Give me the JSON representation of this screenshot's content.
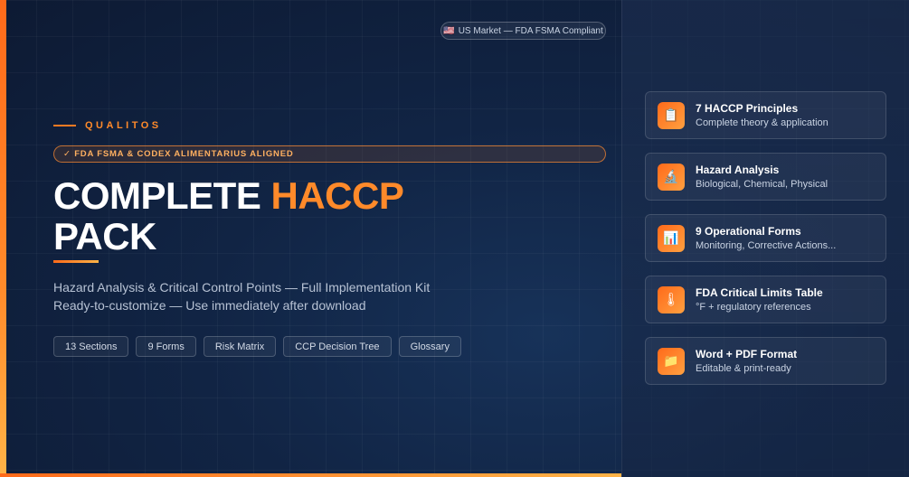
{
  "market_badge": {
    "flag": "🇺🇸",
    "text": "US Market — FDA FSMA Compliant"
  },
  "brand": {
    "name": "QUALITOS"
  },
  "aligned_badge": {
    "text": "✓ FDA FSMA & CODEX ALIMENTARIUS ALIGNED"
  },
  "headline": {
    "part1": "COMPLETE ",
    "accent": "HACCP",
    "part2": "PACK"
  },
  "subtitle": {
    "line1": "Hazard Analysis & Critical Control Points — Full Implementation Kit",
    "line2": "Ready-to-customize — Use immediately after download"
  },
  "chips": [
    "13 Sections",
    "9 Forms",
    "Risk Matrix",
    "CCP Decision Tree",
    "Glossary"
  ],
  "features": [
    {
      "icon": "📋",
      "icon_name": "clipboard-icon",
      "title": "7 HACCP Principles",
      "desc": "Complete theory & application"
    },
    {
      "icon": "🔬",
      "icon_name": "microscope-icon",
      "title": "Hazard Analysis",
      "desc": "Biological, Chemical, Physical"
    },
    {
      "icon": "📊",
      "icon_name": "bar-chart-icon",
      "title": "9 Operational Forms",
      "desc": "Monitoring, Corrective Actions..."
    },
    {
      "icon": "🌡",
      "icon_name": "thermometer-icon",
      "title": "FDA Critical Limits Table",
      "desc": "°F + regulatory references"
    },
    {
      "icon": "📁",
      "icon_name": "folder-icon",
      "title": "Word + PDF Format",
      "desc": "Editable & print-ready"
    }
  ],
  "colors": {
    "accent": "#ff8a2a",
    "background": "#0f1d36"
  }
}
